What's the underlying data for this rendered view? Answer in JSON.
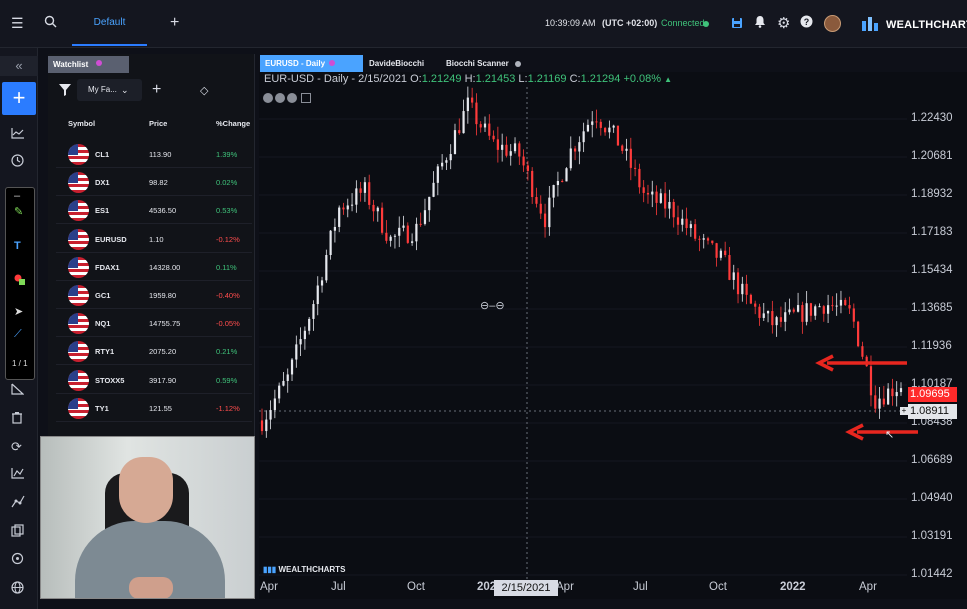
{
  "topbar": {
    "tab_default": "Default",
    "time": "10:39:09 AM",
    "timezone": "(UTC +02:00)",
    "connection": "Connected",
    "brand": "WEALTHCHARTS"
  },
  "watchlist": {
    "tab": "Watchlist",
    "favorites": "My Fa...",
    "columns": [
      "Symbol",
      "Price",
      "%Change"
    ],
    "rows": [
      {
        "symbol": "CL1",
        "price": "113.90",
        "change": "1.39%"
      },
      {
        "symbol": "DX1",
        "price": "98.82",
        "change": "0.02%"
      },
      {
        "symbol": "ES1",
        "price": "4536.50",
        "change": "0.53%"
      },
      {
        "symbol": "EURUSD",
        "price": "1.10",
        "change": "-0.12%"
      },
      {
        "symbol": "FDAX1",
        "price": "14328.00",
        "change": "0.11%"
      },
      {
        "symbol": "GC1",
        "price": "1959.80",
        "change": "-0.40%"
      },
      {
        "symbol": "NQ1",
        "price": "14755.75",
        "change": "-0.05%"
      },
      {
        "symbol": "RTY1",
        "price": "2075.20",
        "change": "0.21%"
      },
      {
        "symbol": "STOXX5",
        "price": "3917.90",
        "change": "0.59%"
      },
      {
        "symbol": "TY1",
        "price": "121.55",
        "change": "-1.12%"
      }
    ]
  },
  "drawing_panel": {
    "page": "1 / 1"
  },
  "chart_tabs": [
    "EURUSD - Daily",
    "DavideBiocchi",
    "Biocchi Scanner"
  ],
  "legend": {
    "title": "EUR-USD - Daily - 2/15/2021",
    "o_label": "O:",
    "open": "1.21249",
    "h_label": "H:",
    "high": "1.21453",
    "l_label": "L:",
    "low": "1.21169",
    "c_label": "C:",
    "close": "1.21294",
    "change": "+0.08%"
  },
  "watermark": "WEALTHCHARTS",
  "date_cursor": "2/15/2021",
  "price_tags": {
    "last": "1.09695",
    "cross": "1.08911"
  },
  "colors": {
    "accent": "#2b7cff",
    "up": "#3fc27a",
    "down": "#ff4d4d",
    "arrow": "#e8261f"
  },
  "chart_data": {
    "type": "candlestick",
    "y_ticks": [
      "1.22430",
      "1.20681",
      "1.18932",
      "1.17183",
      "1.15434",
      "1.13685",
      "1.11936",
      "1.10187",
      "1.08438",
      "1.06689",
      "1.04940",
      "1.03191",
      "1.01442"
    ],
    "x_ticks": [
      "Apr",
      "Jul",
      "Oct",
      "2022",
      "Apr",
      "Jul",
      "Oct",
      "2022",
      "Apr"
    ],
    "ylim": [
      1.005,
      1.24
    ],
    "close_path": [
      [
        "2021-03-01",
        1.08
      ],
      [
        "2021-04-01",
        1.1
      ],
      [
        "2021-05-01",
        1.135
      ],
      [
        "2021-06-01",
        1.18
      ],
      [
        "2021-07-01",
        1.188
      ],
      [
        "2021-08-01",
        1.165
      ],
      [
        "2021-09-01",
        1.17
      ],
      [
        "2021-10-01",
        1.2
      ],
      [
        "2021-11-01",
        1.228
      ],
      [
        "2021-12-01",
        1.21
      ],
      [
        "2022-01-01",
        1.205
      ],
      [
        "2022-02-01",
        1.175
      ],
      [
        "2022-03-01",
        1.205
      ],
      [
        "2022-04-01",
        1.225
      ],
      [
        "2022-05-01",
        1.21
      ],
      [
        "2022-06-01",
        1.185
      ],
      [
        "2022-07-01",
        1.18
      ],
      [
        "2022-08-01",
        1.165
      ],
      [
        "2022-09-01",
        1.155
      ],
      [
        "2022-10-01",
        1.135
      ],
      [
        "2022-11-01",
        1.125
      ],
      [
        "2022-12-01",
        1.13
      ],
      [
        "2023-01-01",
        1.135
      ],
      [
        "2023-02-01",
        1.13
      ],
      [
        "2023-03-01",
        1.09
      ],
      [
        "2023-04-01",
        1.097
      ]
    ],
    "annotations": [
      "arrow-at-1.12",
      "arrow-at-1.08"
    ]
  }
}
